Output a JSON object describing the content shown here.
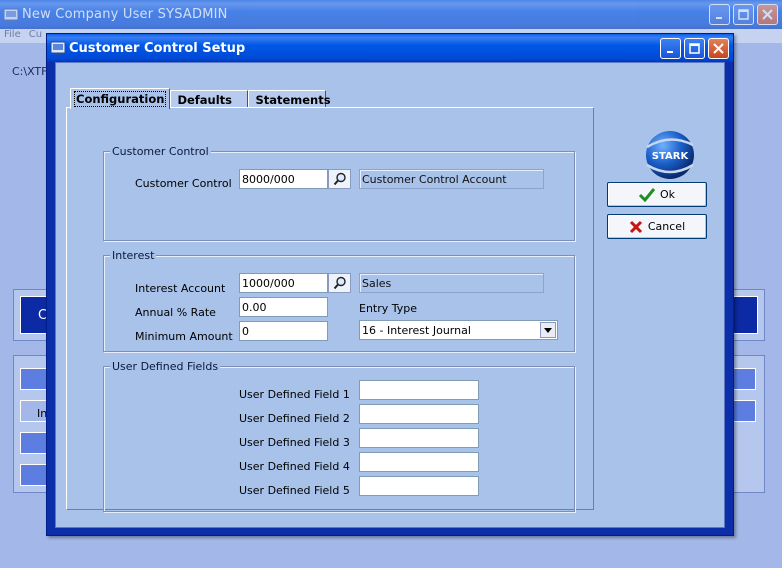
{
  "main_window": {
    "title": "New Company  User SYSADMIN",
    "menu": [
      "File",
      "Cu"
    ],
    "path_text": "C:\\XTF",
    "bar_text": "C",
    "side_button_text": "In"
  },
  "dialog": {
    "title": "Customer Control Setup",
    "tabs": [
      {
        "label": "Configuration",
        "active": true
      },
      {
        "label": "Defaults",
        "active": false
      },
      {
        "label": "Statements",
        "active": false
      }
    ],
    "logo_text": "STARK",
    "customer_control": {
      "group_label": "Customer Control",
      "field_label": "Customer Control",
      "value": "8000/000",
      "description": "Customer Control Account"
    },
    "interest": {
      "group_label": "Interest",
      "account_label": "Interest Account",
      "account_value": "1000/000",
      "account_description": "Sales",
      "annual_label": "Annual % Rate",
      "annual_value": "0.00",
      "minimum_label": "Minimum Amount",
      "minimum_value": "0",
      "entry_type_label": "Entry Type",
      "entry_type_value": "16 - Interest Journal"
    },
    "udf": {
      "group_label": "User Defined Fields",
      "fields": [
        {
          "label": "User Defined Field 1",
          "value": ""
        },
        {
          "label": "User Defined Field 2",
          "value": ""
        },
        {
          "label": "User Defined Field 3",
          "value": ""
        },
        {
          "label": "User Defined Field 4",
          "value": ""
        },
        {
          "label": "User Defined Field 5",
          "value": ""
        }
      ]
    },
    "buttons": {
      "ok": "Ok",
      "cancel": "Cancel"
    }
  },
  "colors": {
    "title_bar": "#0058e6",
    "dialog_bg": "#a8c2ea",
    "frame": "#0c2ea8",
    "ok_check": "#1f8f1f",
    "cancel_x": "#c81414"
  }
}
